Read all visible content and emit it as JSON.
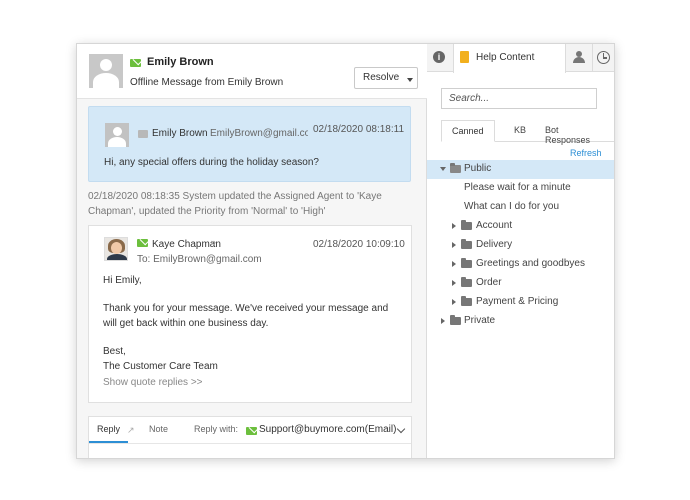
{
  "header": {
    "contact_name": "Emily Brown",
    "subtitle": "Offline Message from Emily Brown",
    "resolve_label": "Resolve"
  },
  "message1": {
    "name": "Emily Brown",
    "email": "EmilyBrown@gmail.com",
    "timestamp": "02/18/2020 08:18:11",
    "text": "Hi, any special offers during the holiday season?"
  },
  "system_message": "02/18/2020 08:18:35 System updated the Assigned Agent to 'Kaye Chapman', updated the Priority from 'Normal' to 'High'",
  "message2": {
    "agent_name": "Kaye Chapman",
    "to": "To: EmilyBrown@gmail.com",
    "timestamp": "02/18/2020 10:09:10",
    "greeting": "Hi Emily,",
    "body": "Thank you for your message. We've received your message and will get back within one business day.",
    "signoff": "Best,",
    "signature": "The Customer Care Team",
    "quote_link": "Show quote replies >>"
  },
  "reply_bar": {
    "reply_tab": "Reply",
    "note_tab": "Note",
    "reply_with_label": "Reply with:",
    "reply_address": "Support@buymore.com(Email)"
  },
  "right_panel": {
    "tab_label": "Help Content",
    "search_placeholder": "Search...",
    "subtabs": [
      "Canned",
      "KB",
      "Bot Responses"
    ],
    "refresh": "Refresh",
    "tree": [
      {
        "label": "Public"
      },
      {
        "label": "Please wait for a minute"
      },
      {
        "label": "What can I do for you"
      },
      {
        "label": "Account"
      },
      {
        "label": "Delivery"
      },
      {
        "label": "Greetings and goodbyes"
      },
      {
        "label": "Order"
      },
      {
        "label": "Payment & Pricing"
      },
      {
        "label": "Private"
      }
    ]
  },
  "colors": {
    "accent": "#2d8fd5",
    "message_bg": "#d4e8f7",
    "email_icon": "#6cbf3d",
    "help_icon": "#f2b01e"
  }
}
